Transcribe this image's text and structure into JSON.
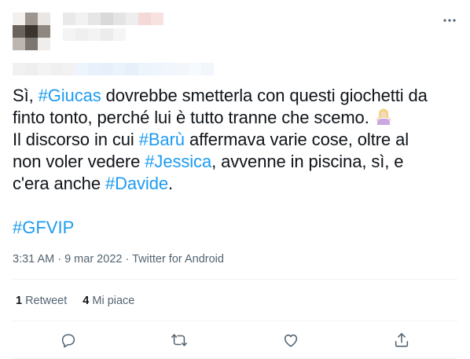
{
  "tweet": {
    "lines": [
      [
        {
          "t": "Sì, "
        },
        {
          "t": "#Giucas",
          "tag": true
        },
        {
          "t": " dovrebbe smetterla con questi giochetti da"
        }
      ],
      [
        {
          "t": "finto tonto, perché lui è tutto tranne che scemo."
        },
        {
          "emoji": "woman-shrugging-emoji"
        }
      ],
      [
        {
          "t": "Il discorso in cui "
        },
        {
          "t": "#Barù",
          "tag": true
        },
        {
          "t": " affermava varie cose, oltre al"
        }
      ],
      [
        {
          "t": "non voler vedere "
        },
        {
          "t": "#Jessica",
          "tag": true
        },
        {
          "t": ", avvenne in piscina, sì, e"
        }
      ],
      [
        {
          "t": "c'era anche "
        },
        {
          "t": "#Davide",
          "tag": true
        },
        {
          "t": "."
        }
      ]
    ],
    "hashtag_footer": "#GFVIP"
  },
  "meta": {
    "time": "3:31 AM",
    "sep1": " · ",
    "date": "9 mar 2022",
    "sep2": " · ",
    "source": "Twitter for Android"
  },
  "stats": {
    "retweets_count": "1",
    "retweets_label": "Retweet",
    "likes_count": "4",
    "likes_label": "Mi piace"
  },
  "actions": [
    {
      "name": "reply-icon"
    },
    {
      "name": "retweet-icon"
    },
    {
      "name": "like-icon"
    },
    {
      "name": "share-icon"
    }
  ],
  "colors": {
    "hashtag": "#1d9bf0",
    "secondary_text": "#536471",
    "divider": "#eff3f4"
  }
}
